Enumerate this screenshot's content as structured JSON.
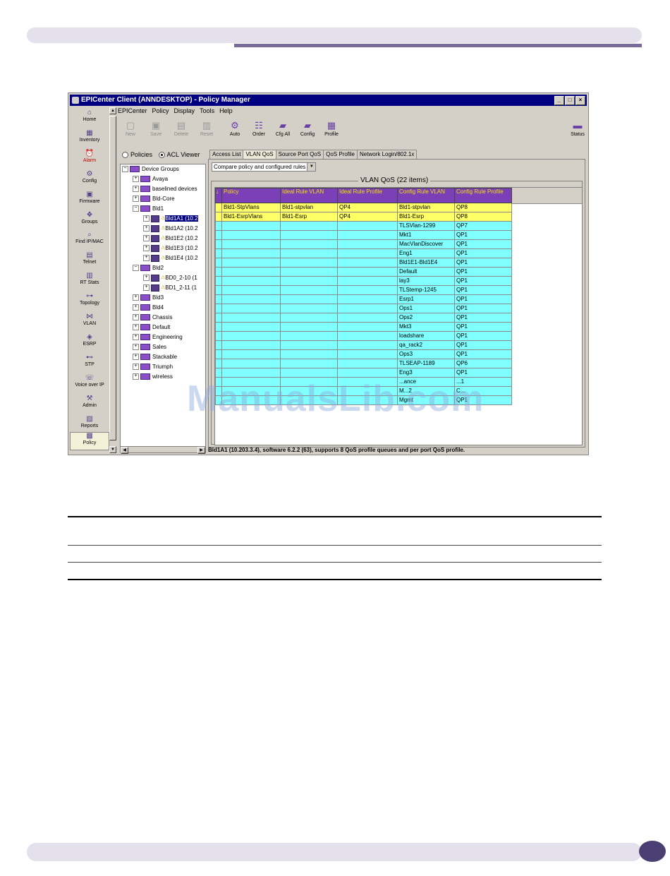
{
  "window": {
    "title": "EPICenter Client (ANNDESKTOP) - Policy Manager",
    "controls": [
      "_",
      "□",
      "×"
    ]
  },
  "menu": [
    "EPICenter",
    "Policy",
    "Display",
    "Tools",
    "Help"
  ],
  "toolbar": [
    {
      "label": "New",
      "icon": "new-icon",
      "enabled": false
    },
    {
      "label": "Save",
      "icon": "save-icon",
      "enabled": false
    },
    {
      "label": "Delete",
      "icon": "delete-icon",
      "enabled": false
    },
    {
      "label": "Reset",
      "icon": "reset-icon",
      "enabled": false
    },
    {
      "label": "Auto",
      "icon": "auto-icon",
      "enabled": true
    },
    {
      "label": "Order",
      "icon": "order-icon",
      "enabled": true
    },
    {
      "label": "Cfg All",
      "icon": "cfg-all-icon",
      "enabled": true
    },
    {
      "label": "Config",
      "icon": "config-icon",
      "enabled": true
    },
    {
      "label": "Profile",
      "icon": "profile-icon",
      "enabled": true
    },
    {
      "label": "Status",
      "icon": "status-icon",
      "enabled": true
    }
  ],
  "nav": [
    {
      "label": "Home",
      "icon": "home-icon"
    },
    {
      "label": "Inventory",
      "icon": "inventory-icon"
    },
    {
      "label": "Alarm",
      "icon": "alarm-icon"
    },
    {
      "label": "Config",
      "icon": "config-icon"
    },
    {
      "label": "Firmware",
      "icon": "firmware-icon"
    },
    {
      "label": "Groups",
      "icon": "groups-icon"
    },
    {
      "label": "Find IP/MAC",
      "icon": "find-icon"
    },
    {
      "label": "Telnet",
      "icon": "telnet-icon"
    },
    {
      "label": "RT Stats",
      "icon": "rt-stats-icon"
    },
    {
      "label": "Topology",
      "icon": "topology-icon"
    },
    {
      "label": "VLAN",
      "icon": "vlan-icon"
    },
    {
      "label": "ESRP",
      "icon": "esrp-icon"
    },
    {
      "label": "STP",
      "icon": "stp-icon"
    },
    {
      "label": "Voice over IP",
      "icon": "voip-icon"
    },
    {
      "label": "Admin",
      "icon": "admin-icon"
    },
    {
      "label": "Reports",
      "icon": "reports-icon"
    },
    {
      "label": "Policy",
      "icon": "policy-icon",
      "active": true
    }
  ],
  "view_mode": {
    "options": [
      "Policies",
      "ACL Viewer"
    ],
    "selected": "ACL Viewer"
  },
  "tree": [
    {
      "label": "Device Groups",
      "level": 0,
      "type": "folder",
      "exp": "−"
    },
    {
      "label": "Avaya",
      "level": 1,
      "type": "folder",
      "exp": "+"
    },
    {
      "label": "baselined devices",
      "level": 1,
      "type": "folder",
      "exp": "+"
    },
    {
      "label": "Bld-Core",
      "level": 1,
      "type": "folder",
      "exp": "+"
    },
    {
      "label": "Bld1",
      "level": 1,
      "type": "folder",
      "exp": "−"
    },
    {
      "label": "Bld1A1 (10.2",
      "level": 2,
      "type": "device",
      "exp": "+",
      "warn": true,
      "selected": true
    },
    {
      "label": "Bld1A2 (10.2",
      "level": 2,
      "type": "device",
      "exp": "+",
      "warn": true
    },
    {
      "label": "Bld1E2 (10.2",
      "level": 2,
      "type": "device",
      "exp": "+",
      "warn": true
    },
    {
      "label": "Bld1E3 (10.2",
      "level": 2,
      "type": "device",
      "exp": "+",
      "warn": true
    },
    {
      "label": "Bld1E4 (10.2",
      "level": 2,
      "type": "device",
      "exp": "+",
      "warn": true
    },
    {
      "label": "Bld2",
      "level": 1,
      "type": "folder",
      "exp": "−"
    },
    {
      "label": "BD0_2-10 (1",
      "level": 2,
      "type": "device",
      "exp": "+",
      "warn": true
    },
    {
      "label": "BD1_2-11 (1",
      "level": 2,
      "type": "device",
      "exp": "+",
      "warn": true
    },
    {
      "label": "Bld3",
      "level": 1,
      "type": "folder",
      "exp": "+"
    },
    {
      "label": "Bld4",
      "level": 1,
      "type": "folder",
      "exp": "+"
    },
    {
      "label": "Chassis",
      "level": 1,
      "type": "folder",
      "exp": "+"
    },
    {
      "label": "Default",
      "level": 1,
      "type": "folder",
      "exp": "+"
    },
    {
      "label": "Engineering",
      "level": 1,
      "type": "folder",
      "exp": "+"
    },
    {
      "label": "Sales",
      "level": 1,
      "type": "folder",
      "exp": "+"
    },
    {
      "label": "Stackable",
      "level": 1,
      "type": "folder",
      "exp": "+"
    },
    {
      "label": "Triumph",
      "level": 1,
      "type": "folder",
      "exp": "+"
    },
    {
      "label": "wireless",
      "level": 1,
      "type": "folder",
      "exp": "+"
    }
  ],
  "tabs": [
    {
      "label": "Access List",
      "active": false
    },
    {
      "label": "VLAN QoS",
      "active": true
    },
    {
      "label": "Source Port QoS",
      "active": false
    },
    {
      "label": "QoS Profile",
      "active": false
    },
    {
      "label": "Network Login/802.1x",
      "active": false
    }
  ],
  "filter": {
    "selected": "Compare policy and configured rules"
  },
  "group_title": "VLAN QoS (22 items)",
  "table": {
    "headers": [
      "",
      "Policy",
      "Ideal Rule VLAN",
      "Ideal Rule Profile",
      "Config Rule VLAN",
      "Config Rule Profile"
    ],
    "rows": [
      {
        "hl": true,
        "cells": [
          "",
          "Bld1-StpVlans",
          "Bld1-stpvlan",
          "QP4",
          "Bld1-stpvlan",
          "QP8"
        ]
      },
      {
        "hl": true,
        "cells": [
          "",
          "Bld1-EsrpVlans",
          "Bld1-Esrp",
          "QP4",
          "Bld1-Esrp",
          "QP8"
        ]
      },
      {
        "hl": false,
        "cells": [
          "",
          "",
          "",
          "",
          "TLSVlan-1299",
          "QP7"
        ]
      },
      {
        "hl": false,
        "cells": [
          "",
          "",
          "",
          "",
          "Mkt1",
          "QP1"
        ]
      },
      {
        "hl": false,
        "cells": [
          "",
          "",
          "",
          "",
          "MacVlanDiscover",
          "QP1"
        ]
      },
      {
        "hl": false,
        "cells": [
          "",
          "",
          "",
          "",
          "Eng1",
          "QP1"
        ]
      },
      {
        "hl": false,
        "cells": [
          "",
          "",
          "",
          "",
          "Bld1E1-Bld1E4",
          "QP1"
        ]
      },
      {
        "hl": false,
        "cells": [
          "",
          "",
          "",
          "",
          "Default",
          "QP1"
        ]
      },
      {
        "hl": false,
        "cells": [
          "",
          "",
          "",
          "",
          "lay3",
          "QP1"
        ]
      },
      {
        "hl": false,
        "cells": [
          "",
          "",
          "",
          "",
          "TLStemp-1245",
          "QP1"
        ]
      },
      {
        "hl": false,
        "cells": [
          "",
          "",
          "",
          "",
          "Esrp1",
          "QP1"
        ]
      },
      {
        "hl": false,
        "cells": [
          "",
          "",
          "",
          "",
          "Ops1",
          "QP1"
        ]
      },
      {
        "hl": false,
        "cells": [
          "",
          "",
          "",
          "",
          "Ops2",
          "QP1"
        ]
      },
      {
        "hl": false,
        "cells": [
          "",
          "",
          "",
          "",
          "Mkt3",
          "QP1"
        ]
      },
      {
        "hl": false,
        "cells": [
          "",
          "",
          "",
          "",
          "loadshare",
          "QP1"
        ]
      },
      {
        "hl": false,
        "cells": [
          "",
          "",
          "",
          "",
          "qa_rack2",
          "QP1"
        ]
      },
      {
        "hl": false,
        "cells": [
          "",
          "",
          "",
          "",
          "Ops3",
          "QP1"
        ]
      },
      {
        "hl": false,
        "cells": [
          "",
          "",
          "",
          "",
          "TLSEAP-1189",
          "QP6"
        ]
      },
      {
        "hl": false,
        "cells": [
          "",
          "",
          "",
          "",
          "Eng3",
          "QP1"
        ]
      },
      {
        "hl": false,
        "cells": [
          "",
          "",
          "",
          "",
          "...ance",
          "...1"
        ]
      },
      {
        "hl": false,
        "cells": [
          "",
          "",
          "",
          "",
          "M...2",
          "C..."
        ]
      },
      {
        "hl": false,
        "cells": [
          "",
          "",
          "",
          "",
          "Mgmt",
          "QP1"
        ]
      }
    ]
  },
  "status_text": "Bld1A1 (10.203.3.4), software 6.2.2 (63), supports 8 QoS profile queues and per port QoS profile.",
  "watermark": "ManualsLib.com"
}
